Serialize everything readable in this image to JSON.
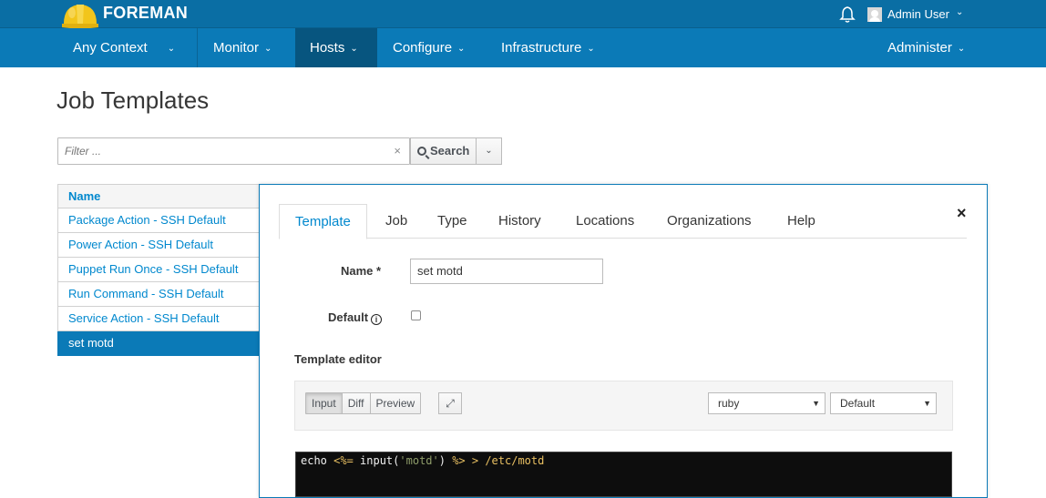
{
  "app": {
    "brand": "FOREMAN"
  },
  "user": {
    "name": "Admin User"
  },
  "nav": {
    "items": [
      {
        "label": "Any Context"
      },
      {
        "label": "Monitor"
      },
      {
        "label": "Hosts"
      },
      {
        "label": "Configure"
      },
      {
        "label": "Infrastructure"
      },
      {
        "label": "Administer"
      }
    ]
  },
  "page": {
    "title": "Job Templates"
  },
  "search": {
    "placeholder": "Filter ...",
    "button_label": "Search"
  },
  "list": {
    "header": "Name",
    "rows": [
      "Package Action - SSH Default",
      "Power Action - SSH Default",
      "Puppet Run Once - SSH Default",
      "Run Command - SSH Default",
      "Service Action - SSH Default",
      "set motd"
    ],
    "selected_index": 5
  },
  "editor": {
    "tabs": [
      "Template",
      "Job",
      "Type",
      "History",
      "Locations",
      "Organizations",
      "Help"
    ],
    "active_tab": "Template",
    "name_label": "Name *",
    "name_value": "set motd",
    "default_label": "Default",
    "default_checked": false,
    "template_editor_label": "Template editor",
    "mode_buttons": [
      "Input",
      "Diff",
      "Preview"
    ],
    "active_mode": "Input",
    "syntax_select": "ruby",
    "theme_select": "Default",
    "code": {
      "part1": "echo ",
      "open_tag": "<%=",
      "part2": " input(",
      "string": "'motd'",
      "part3": ") ",
      "close_tag": "%>",
      "part4": " > /etc/motd"
    }
  },
  "colors": {
    "header": "#0a6ea4",
    "nav": "#0b7ab7",
    "nav_active": "#07557f",
    "link": "#0088ce"
  }
}
